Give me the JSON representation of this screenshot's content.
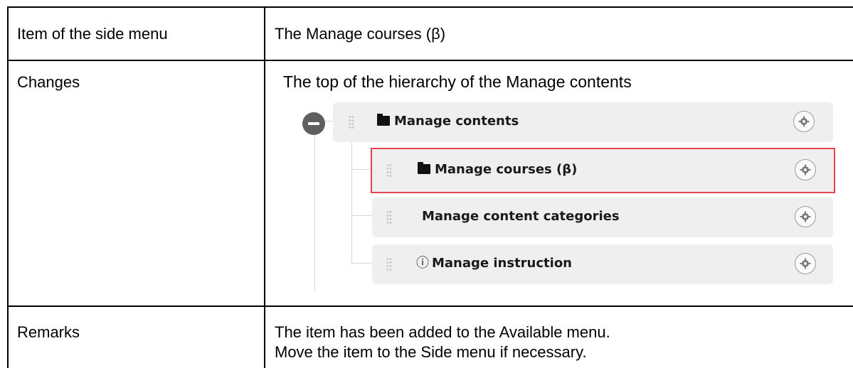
{
  "rows": [
    {
      "label": "Item of the side menu",
      "value": "The Manage courses (β)"
    },
    {
      "label": "Changes",
      "value": "The top of the hierarchy of the Manage contents"
    },
    {
      "label": "Remarks",
      "value_lines": [
        "The item has been added to the Available menu.",
        "Move the item to the Side menu if necessary."
      ]
    }
  ],
  "menu_tree": {
    "root": {
      "label": "Manage contents",
      "icon": "folder-icon",
      "action_icon": "gear-icon",
      "toggle_icon": "collapse-icon"
    },
    "children": [
      {
        "label": "Manage courses (β)",
        "icon": "folder-icon",
        "highlighted": true,
        "action_icon": "gear-icon"
      },
      {
        "label": "Manage content categories",
        "icon": "",
        "action_icon": "gear-icon"
      },
      {
        "label": "Manage instruction",
        "icon": "chat-alert-icon",
        "action_icon": "gear-icon"
      }
    ],
    "highlight_color": "#e0464b"
  }
}
